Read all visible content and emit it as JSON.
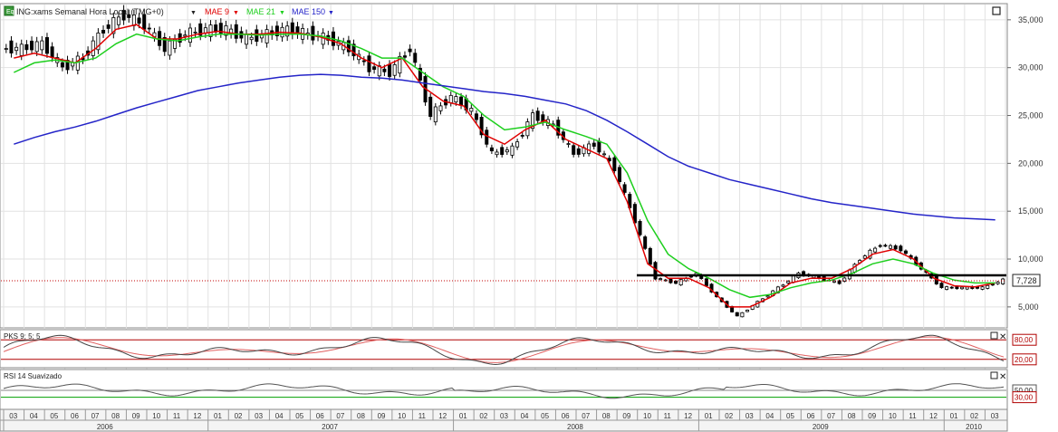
{
  "header": {
    "symbol_label": "ING:xams Semanal Hora Local (TMG+0)",
    "ma_short_label": "MAE 9",
    "ma_mid_label": "MAE 21",
    "ma_long_label": "MAE 150",
    "price_tag": "7,728"
  },
  "colors": {
    "candle": "#000000",
    "ma_short": "#e00000",
    "ma_mid": "#1ecf1e",
    "ma_long": "#2424c8",
    "stoch_k": "#444444",
    "stoch_d": "#e06060",
    "rsi": "#555555",
    "level_line": "#c00000",
    "rsi_level": "#00a000",
    "support": "#000000"
  },
  "chart_data": [
    {
      "type": "candlestick",
      "title": "ING:xams Semanal Hora Local (TMG+0)",
      "x": [
        "03",
        "04",
        "05",
        "06",
        "07",
        "08",
        "09",
        "10",
        "11",
        "12",
        "01",
        "02",
        "03",
        "04",
        "05",
        "06",
        "07",
        "08",
        "09",
        "10",
        "11",
        "12",
        "01",
        "02",
        "03",
        "04",
        "05",
        "06",
        "07",
        "08",
        "09",
        "10",
        "11",
        "12",
        "01",
        "02",
        "03",
        "04",
        "05",
        "06",
        "07",
        "08",
        "09",
        "10",
        "11",
        "12",
        "01",
        "02",
        "03"
      ],
      "years": [
        "2006",
        "2007",
        "2008",
        "2009",
        "2010"
      ],
      "monthly_close": [
        32000,
        32500,
        30000,
        31000,
        34000,
        35500,
        34500,
        32000,
        33500,
        34000,
        34000,
        33000,
        33500,
        34000,
        33500,
        33000,
        32000,
        30000,
        29500,
        32000,
        25000,
        27000,
        25500,
        21000,
        21500,
        25000,
        24000,
        21000,
        22000,
        19500,
        14000,
        8000,
        7500,
        8500,
        6000,
        4000,
        5500,
        7000,
        8500,
        8000,
        7500,
        10000,
        11500,
        11000,
        9000,
        7000,
        7000,
        7000,
        7800
      ],
      "last_price": 7728,
      "ylim": [
        3000,
        36500
      ],
      "yticks": [
        "35,000",
        "30,000",
        "25,000",
        "20,000",
        "15,000",
        "10,000",
        "5,000"
      ],
      "series": [
        {
          "name": "MAE 9",
          "monthly_values": [
            31000,
            31500,
            31000,
            30500,
            32000,
            34000,
            34500,
            33000,
            33000,
            33500,
            33800,
            33500,
            33500,
            33700,
            33600,
            33200,
            32500,
            31000,
            30000,
            31000,
            28000,
            26500,
            26000,
            23000,
            22000,
            23500,
            24500,
            22500,
            21500,
            20500,
            16000,
            9500,
            8000,
            8000,
            7000,
            5000,
            5000,
            6000,
            7500,
            8000,
            8000,
            9000,
            10500,
            11000,
            10000,
            8000,
            7200,
            7100,
            7500
          ]
        },
        {
          "name": "MAE 21",
          "monthly_values": [
            29500,
            30500,
            30800,
            30500,
            31000,
            32500,
            33500,
            33000,
            32800,
            33200,
            33500,
            33500,
            33400,
            33500,
            33500,
            33300,
            32800,
            32000,
            31000,
            31000,
            29500,
            28000,
            27000,
            25000,
            23500,
            23800,
            24300,
            23500,
            22800,
            22000,
            19000,
            14000,
            10500,
            9000,
            8000,
            6800,
            6000,
            6300,
            7000,
            7500,
            7800,
            8500,
            9500,
            10000,
            9500,
            8500,
            7800,
            7500,
            7500
          ]
        },
        {
          "name": "MAE 150",
          "monthly_values": [
            22000,
            22700,
            23300,
            23800,
            24400,
            25100,
            25800,
            26400,
            27000,
            27600,
            28000,
            28400,
            28700,
            29000,
            29200,
            29300,
            29200,
            29000,
            28900,
            28700,
            28400,
            28100,
            27800,
            27500,
            27300,
            27000,
            26600,
            26200,
            25500,
            24500,
            23300,
            22000,
            20700,
            19700,
            19000,
            18300,
            17800,
            17300,
            16800,
            16300,
            15900,
            15600,
            15300,
            15000,
            14700,
            14500,
            14300,
            14200,
            14100
          ]
        }
      ]
    },
    {
      "type": "line",
      "title": "PKS 9; 5; 5",
      "ylim": [
        0,
        100
      ],
      "levels": [
        80,
        20
      ],
      "level_labels": [
        "80,00",
        "20,00"
      ]
    },
    {
      "type": "line",
      "title": "RSI 14 Suavizado",
      "ylim": [
        0,
        100
      ],
      "levels": [
        50,
        30
      ],
      "level_labels": [
        "50,00",
        "30,00"
      ]
    }
  ]
}
